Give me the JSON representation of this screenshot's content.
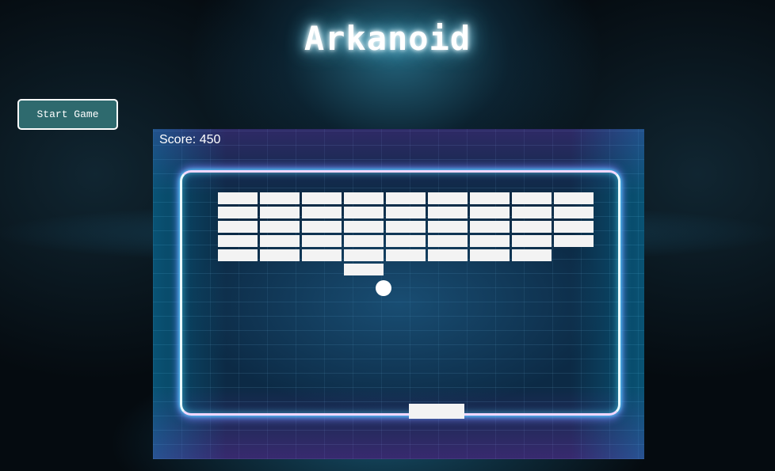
{
  "page": {
    "title": "Arkanoid"
  },
  "controls": {
    "start_label": "Start Game"
  },
  "game": {
    "score_label": "Score: ",
    "score": 450,
    "brick_grid": {
      "columns": 9,
      "rows": 6,
      "present_rows": [
        [
          1,
          1,
          1,
          1,
          1,
          1,
          1,
          1,
          1
        ],
        [
          1,
          1,
          1,
          1,
          1,
          1,
          1,
          1,
          1
        ],
        [
          1,
          1,
          1,
          1,
          1,
          1,
          1,
          1,
          1
        ],
        [
          1,
          1,
          1,
          1,
          1,
          1,
          1,
          1,
          1
        ],
        [
          1,
          1,
          1,
          1,
          1,
          1,
          1,
          1,
          0
        ],
        [
          0,
          0,
          0,
          1,
          0,
          0,
          0,
          0,
          0
        ]
      ]
    },
    "colors": {
      "brick": "#f3f3f3",
      "ball": "#ffffff",
      "paddle": "#f3f3f3",
      "button_bg": "#2e6a6e",
      "neon_cyan": "#4fe3ff",
      "neon_magenta": "#e63cff"
    }
  }
}
